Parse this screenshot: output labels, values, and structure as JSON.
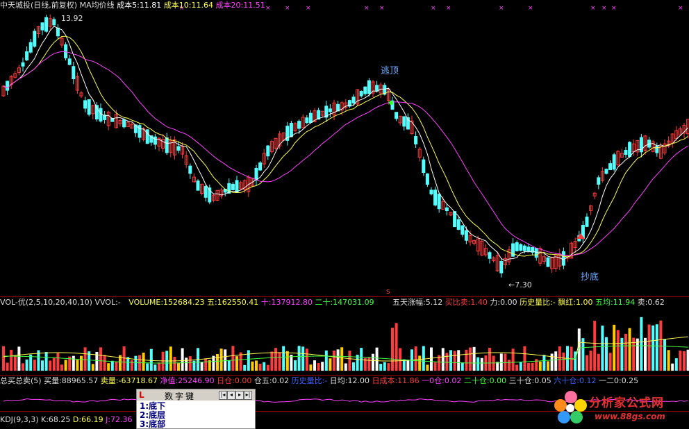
{
  "colors": {
    "up": "#ff3b3b",
    "down": "#54ffff",
    "ma5": "#ffffff",
    "ma10": "#ffff50",
    "ma20": "#ff40ff",
    "label": "#6aa8ff",
    "grid": "#a00000"
  },
  "header": {
    "stock": "中天城投(日线,前复权)",
    "indicator": "MA均价线",
    "ma5_label": "成本5:11.81",
    "ma10_label": "成本10:11.64",
    "ma20_label": "成本20:11.51"
  },
  "annotations": {
    "high": "13.92",
    "low": "←7.30",
    "top_signal": "逃顶",
    "bottom_signal": "抄底",
    "s_marker": "s"
  },
  "vol_header": {
    "name": "VOL-优(2,5,10,20,40,10)",
    "vvol": "VVOL:-",
    "volume": "VOLUME:152684.23",
    "five": "五:162550.41",
    "ten": "十:137912.80",
    "twenty": "二十:147031.09",
    "rise": "五天涨幅:5.12",
    "buysell_ratio": "买比卖:1.40",
    "force": "力:0.00",
    "hist_ratio": "历史量比:-",
    "piaohong": "飘红:1.00",
    "avg5": "五均:11.94",
    "sell": "卖:0.62"
  },
  "ind_header": {
    "name": "总买总卖(5)",
    "buy": "买量:88965.57",
    "sell": "卖量:-63718.67",
    "net": "净值:25246.90",
    "day_pos": "日仓:0.00",
    "pos5": "仓五:0.02",
    "hist": "历史量比:-",
    "day_avg": "日均:12.00",
    "day_cost": "日成本:11.86",
    "pos1": "一0仓:0.02",
    "pos20": "二十仓:0.00",
    "pos30": "三十仓:0.05",
    "pos60": "六十仓:0.12",
    "pos12": "一二0:0.25"
  },
  "kdj": {
    "name": "KDJ(9,3,3)",
    "k": "K:68.25",
    "d": "D:66.19",
    "j": "J:72.36"
  },
  "key_panel": {
    "logo": "L",
    "title": "数字键",
    "items": [
      "1:底下",
      "2:底层",
      "3:底部"
    ]
  },
  "watermark": {
    "name": "分析家公式网",
    "url": "www.88gs.com"
  }
}
